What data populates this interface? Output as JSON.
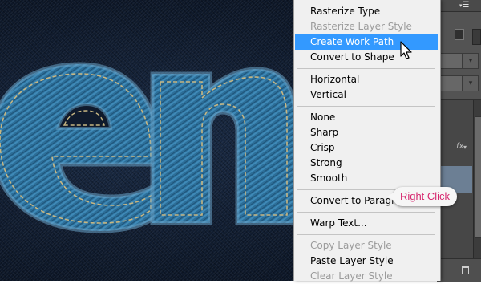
{
  "canvas": {
    "background": "#101b2e",
    "denim_color": "#2e6f99",
    "stitch_color": "#c7b682"
  },
  "context_menu": {
    "groups": [
      [
        {
          "label": "Rasterize Type",
          "enabled": true
        },
        {
          "label": "Rasterize Layer Style",
          "enabled": false
        },
        {
          "label": "Create Work Path",
          "enabled": true,
          "highlighted": true
        },
        {
          "label": "Convert to Shape",
          "enabled": true
        }
      ],
      [
        {
          "label": "Horizontal",
          "enabled": true
        },
        {
          "label": "Vertical",
          "enabled": true
        }
      ],
      [
        {
          "label": "None",
          "enabled": true
        },
        {
          "label": "Sharp",
          "enabled": true
        },
        {
          "label": "Crisp",
          "enabled": true
        },
        {
          "label": "Strong",
          "enabled": true
        },
        {
          "label": "Smooth",
          "enabled": true
        }
      ],
      [
        {
          "label": "Convert to Paragraph",
          "enabled": true
        }
      ],
      [
        {
          "label": "Warp Text...",
          "enabled": true
        }
      ],
      [
        {
          "label": "Copy Layer Style",
          "enabled": false
        },
        {
          "label": "Paste Layer Style",
          "enabled": true
        },
        {
          "label": "Clear Layer Style",
          "enabled": false
        }
      ]
    ],
    "highlight_color": "#3399ff"
  },
  "callout": {
    "label": "Right Click",
    "text_color": "#d6276e"
  },
  "side_panel": {
    "fx_label": "fx"
  }
}
